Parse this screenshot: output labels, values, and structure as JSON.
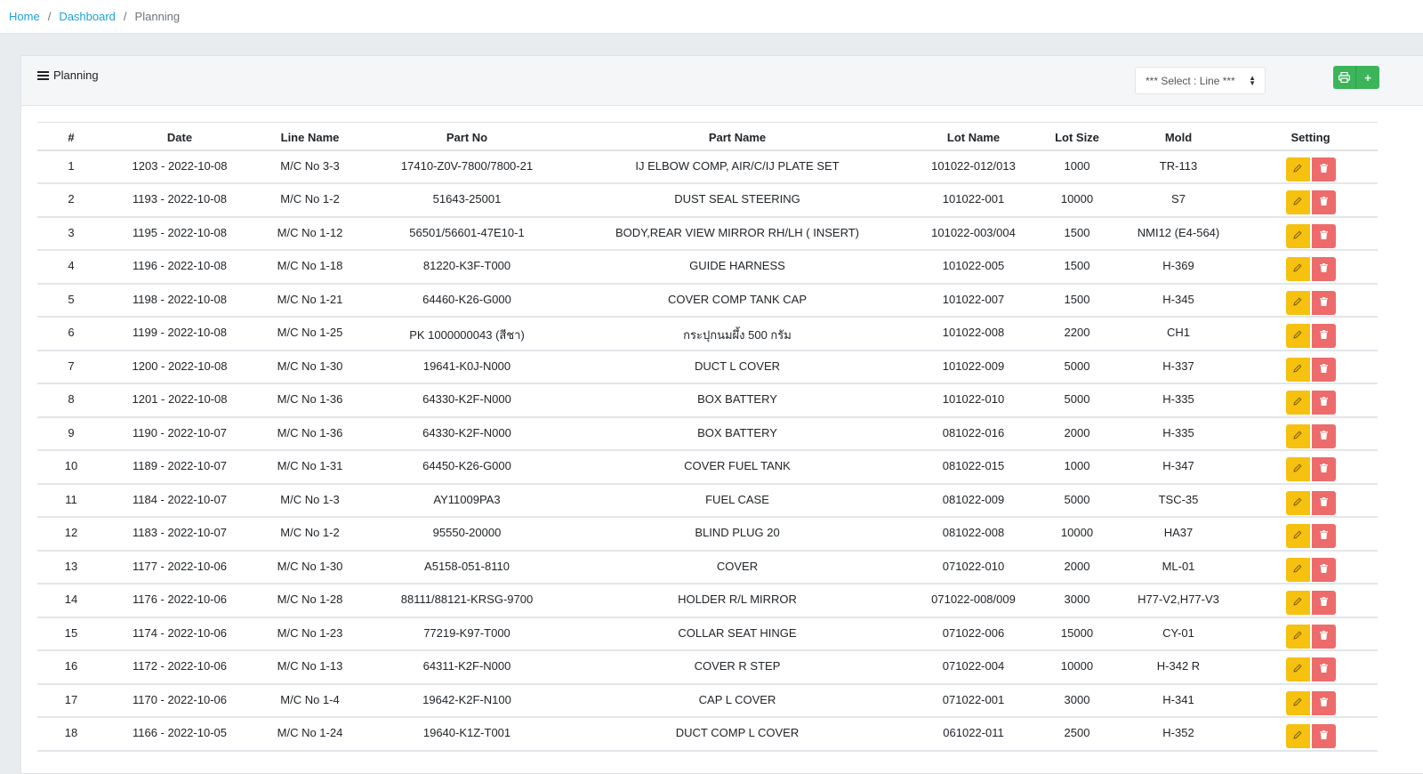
{
  "breadcrumb": {
    "home": "Home",
    "dashboard": "Dashboard",
    "current": "Planning",
    "sep": "/"
  },
  "card": {
    "title": "Planning"
  },
  "filter": {
    "select_label": "*** Select : Line ***"
  },
  "buttons": {
    "print_icon": "printer-icon",
    "add_label": "+"
  },
  "colors": {
    "link": "#20a0d8",
    "green": "#3cb55a",
    "edit": "#f6c10f",
    "delete": "#ed6b6b"
  },
  "table": {
    "headers": [
      "#",
      "Date",
      "Line Name",
      "Part No",
      "Part Name",
      "Lot Name",
      "Lot Size",
      "Mold",
      "Setting"
    ],
    "rows": [
      [
        "1",
        "1203 - 2022-10-08",
        "M/C No 3-3",
        "17410-Z0V-7800/7800-21",
        "IJ ELBOW COMP, AIR/C/IJ PLATE SET",
        "101022-012/013",
        "1000",
        "TR-113"
      ],
      [
        "2",
        "1193 - 2022-10-08",
        "M/C No 1-2",
        "51643-25001",
        "DUST SEAL STEERING",
        "101022-001",
        "10000",
        "S7"
      ],
      [
        "3",
        "1195 - 2022-10-08",
        "M/C No 1-12",
        "56501/56601-47E10-1",
        "BODY,REAR VIEW MIRROR RH/LH ( INSERT)",
        "101022-003/004",
        "1500",
        "NMI12 (E4-564)"
      ],
      [
        "4",
        "1196 - 2022-10-08",
        "M/C No 1-18",
        "81220-K3F-T000",
        "GUIDE HARNESS",
        "101022-005",
        "1500",
        "H-369"
      ],
      [
        "5",
        "1198 - 2022-10-08",
        "M/C No 1-21",
        "64460-K26-G000",
        "COVER COMP TANK CAP",
        "101022-007",
        "1500",
        "H-345"
      ],
      [
        "6",
        "1199 - 2022-10-08",
        "M/C No 1-25",
        "PK 1000000043 (สีชา)",
        "กระปุกนมผึ้ง 500 กรัม",
        "101022-008",
        "2200",
        "CH1"
      ],
      [
        "7",
        "1200 - 2022-10-08",
        "M/C No 1-30",
        "19641-K0J-N000",
        "DUCT L COVER",
        "101022-009",
        "5000",
        "H-337"
      ],
      [
        "8",
        "1201 - 2022-10-08",
        "M/C No 1-36",
        "64330-K2F-N000",
        "BOX BATTERY",
        "101022-010",
        "5000",
        "H-335"
      ],
      [
        "9",
        "1190 - 2022-10-07",
        "M/C No 1-36",
        "64330-K2F-N000",
        "BOX BATTERY",
        "081022-016",
        "2000",
        "H-335"
      ],
      [
        "10",
        "1189 - 2022-10-07",
        "M/C No 1-31",
        "64450-K26-G000",
        "COVER FUEL TANK",
        "081022-015",
        "1000",
        "H-347"
      ],
      [
        "11",
        "1184 - 2022-10-07",
        "M/C No 1-3",
        "AY11009PA3",
        "FUEL CASE",
        "081022-009",
        "5000",
        "TSC-35"
      ],
      [
        "12",
        "1183 - 2022-10-07",
        "M/C No 1-2",
        "95550-20000",
        "BLIND PLUG 20",
        "081022-008",
        "10000",
        "HA37"
      ],
      [
        "13",
        "1177 - 2022-10-06",
        "M/C No 1-30",
        "A5158-051-8110",
        "COVER",
        "071022-010",
        "2000",
        "ML-01"
      ],
      [
        "14",
        "1176 - 2022-10-06",
        "M/C No 1-28",
        "88111/88121-KRSG-9700",
        "HOLDER R/L MIRROR",
        "071022-008/009",
        "3000",
        "H77-V2,H77-V3"
      ],
      [
        "15",
        "1174 - 2022-10-06",
        "M/C No 1-23",
        "77219-K97-T000",
        "COLLAR SEAT HINGE",
        "071022-006",
        "15000",
        "CY-01"
      ],
      [
        "16",
        "1172 - 2022-10-06",
        "M/C No 1-13",
        "64311-K2F-N000",
        "COVER R STEP",
        "071022-004",
        "10000",
        "H-342 R"
      ],
      [
        "17",
        "1170 - 2022-10-06",
        "M/C No 1-4",
        "19642-K2F-N100",
        "CAP L COVER",
        "071022-001",
        "3000",
        "H-341"
      ],
      [
        "18",
        "1166 - 2022-10-05",
        "M/C No 1-24",
        "19640-K1Z-T001",
        "DUCT COMP L COVER",
        "061022-011",
        "2500",
        "H-352"
      ]
    ]
  }
}
